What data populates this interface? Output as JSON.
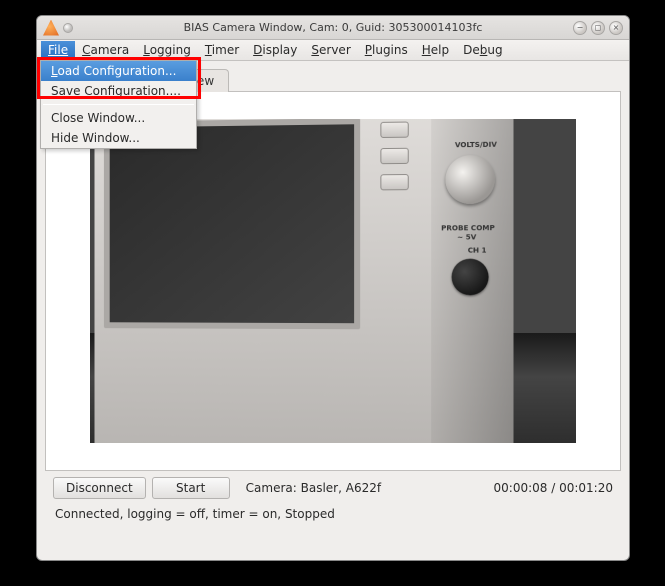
{
  "title": "BIAS Camera Window, Cam: 0, Guid: 305300014103fc",
  "menubar": {
    "file": "File",
    "camera": "Camera",
    "logging": "Logging",
    "timer": "Timer",
    "display": "Display",
    "server": "Server",
    "plugins": "Plugins",
    "help": "Help",
    "debug": "Debug"
  },
  "file_menu": {
    "load": "Load Configuration...",
    "save": "Save Configuration....",
    "close": "Close Window...",
    "hide": "Hide Window..."
  },
  "tabs": {
    "preview": "n Preview"
  },
  "buttons": {
    "disconnect": "Disconnect",
    "start": "Start"
  },
  "camera_text": "Camera: Basler,  A622f",
  "time_text": "00:00:08 / 00:01:20",
  "status_text": "Connected, logging = off, timer = on, Stopped",
  "scope": {
    "ch1": "CH 1",
    "volts_div": "VOLTS/DIV",
    "probe_comp": "PROBE COMP",
    "probe_v": "~ 5V"
  }
}
